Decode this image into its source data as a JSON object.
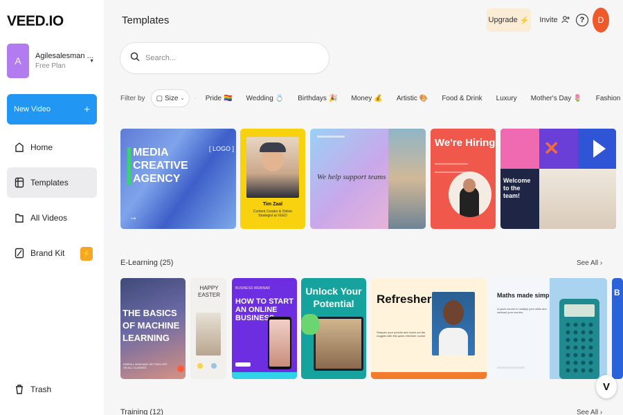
{
  "sidebar": {
    "logo": "VEED.IO",
    "workspace": {
      "avatar_letter": "A",
      "name": "Agilesalesman ...",
      "plan": "Free Plan"
    },
    "new_video": "New Video",
    "items": [
      {
        "label": "Home",
        "icon": "home-icon"
      },
      {
        "label": "Templates",
        "icon": "templates-icon",
        "active": true
      },
      {
        "label": "All Videos",
        "icon": "folder-icon"
      },
      {
        "label": "Brand Kit",
        "icon": "brand-kit-icon",
        "badge_icon": "lightning-icon"
      }
    ],
    "trash": "Trash"
  },
  "header": {
    "title": "Templates",
    "upgrade": "Upgrade",
    "invite": "Invite",
    "help": "?",
    "avatar_letter": "D"
  },
  "search": {
    "placeholder": "Search..."
  },
  "filters": {
    "label": "Filter by",
    "size": "Size",
    "chips": [
      "Pride",
      "Wedding",
      "Birthdays",
      "Money",
      "Artistic",
      "Food & Drink",
      "Luxury",
      "Mother's Day",
      "Fashion"
    ],
    "chip_emojis": [
      "🏳️‍🌈",
      "💍",
      "🎉",
      "💰",
      "🎨",
      "",
      "",
      "🌷",
      "✏️"
    ],
    "more": "···"
  },
  "top_row": {
    "media": {
      "title": "MEDIA CREATIVE AGENCY",
      "logo_tag": "[ LOGO ]",
      "arrow": "→"
    },
    "person": {
      "name": "Tim Zaal",
      "role": "Content Creator & Online Strategist at VEED"
    },
    "support": {
      "text": "We help support teams"
    },
    "hiring": {
      "title": "We're Hiring"
    },
    "welcome": {
      "text": "Welcome to the team!"
    }
  },
  "elearning": {
    "title": "E-Learning (25)",
    "see_all": "See All",
    "cards": {
      "basics": {
        "title": "THE BASICS OF MACHINE LEARNING",
        "small": "ENROLL NOW AND GET 50% OFF ON ALL CLASSES"
      },
      "easter": {
        "title": "HAPPY EASTER"
      },
      "business": {
        "tag": "BUSINESS WEBINAR",
        "title": "HOW TO START AN ONLINE BUSINESS"
      },
      "unlock": {
        "title": "Unlock Your Potential"
      },
      "refresher": {
        "title": "Refresher Course",
        "small": "Sharpen your pencils and check out the nuggets with this quick refresher course"
      },
      "maths": {
        "title": "Maths made simple",
        "small": "A quick course to multiply your skills and subtract your worries."
      },
      "partial": {
        "text": "B"
      }
    }
  },
  "training": {
    "title": "Training (12)",
    "see_all": "See All"
  }
}
